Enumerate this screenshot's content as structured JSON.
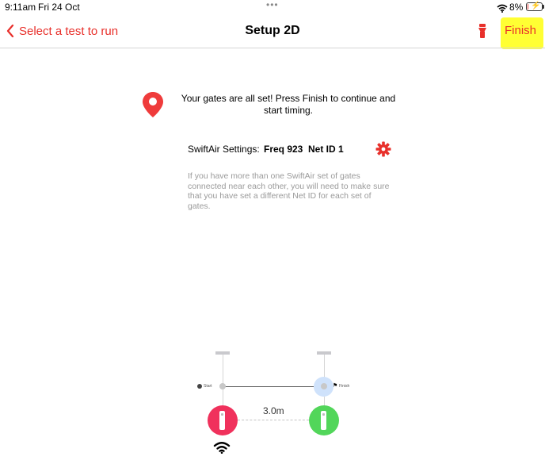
{
  "status_bar": {
    "time": "9:11am",
    "date": "Fri 24 Oct",
    "dots": "•••",
    "battery_percent": "8%",
    "battery_level": 0.08
  },
  "nav": {
    "back_label": "Select a test to run",
    "title": "Setup 2D",
    "finish_label": "Finish"
  },
  "content": {
    "message": "Your gates are all set! Press Finish to continue and start timing.",
    "settings_label": "SwiftAir Settings:",
    "freq": "Freq 923",
    "net_id": "Net ID 1",
    "help_text": "If you have more than one SwiftAir set of gates connected near each other, you will need to make sure that you have set a different Net ID for each set of gates."
  },
  "diagram": {
    "start_label": "Start",
    "finish_label": "Finish",
    "distance": "3.0m"
  },
  "colors": {
    "accent": "#e8302b",
    "highlight": "#ffff33",
    "start_gate": "#f0315c",
    "finish_gate": "#52d65a",
    "help_text": "#9a9a9a"
  }
}
